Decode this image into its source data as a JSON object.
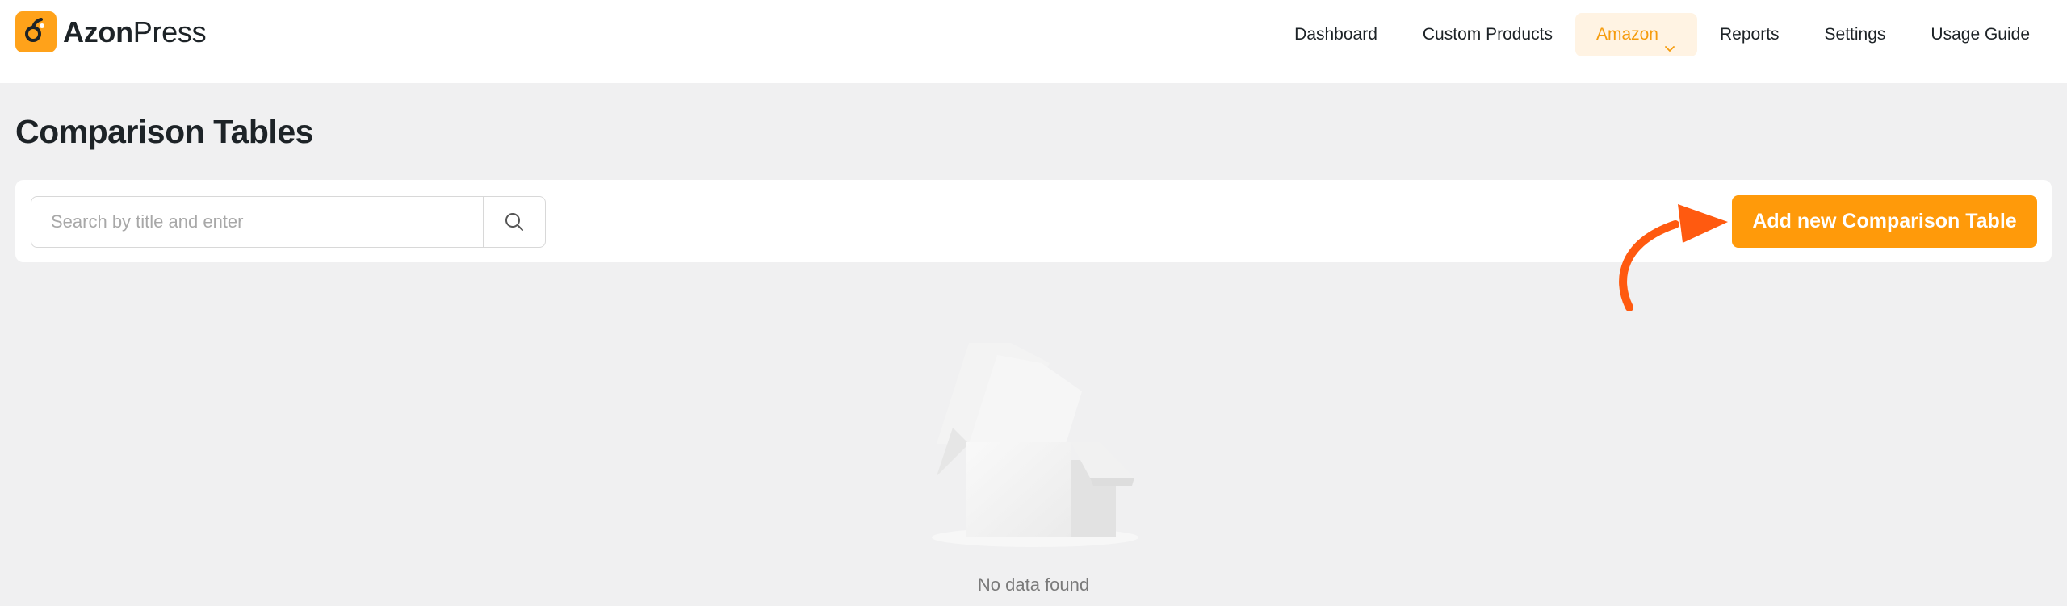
{
  "brand": {
    "name_bold": "Azon",
    "name_light": "Press",
    "accent": "#ffa21a"
  },
  "nav": {
    "items": [
      {
        "label": "Dashboard"
      },
      {
        "label": "Custom Products"
      },
      {
        "label": "Amazon",
        "active": true
      },
      {
        "label": "Reports"
      },
      {
        "label": "Settings"
      },
      {
        "label": "Usage Guide"
      }
    ]
  },
  "page": {
    "title": "Comparison Tables"
  },
  "search": {
    "placeholder": "Search by title and enter",
    "value": ""
  },
  "actions": {
    "add_label": "Add new Comparison Table",
    "add_color": "#ff9a0a"
  },
  "empty_state": {
    "message": "No data found"
  },
  "colors": {
    "arrow": "#ff5a10",
    "active_nav_bg": "#fff3e3",
    "active_nav_text": "#f59b0c"
  }
}
